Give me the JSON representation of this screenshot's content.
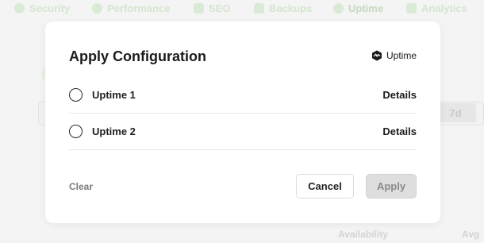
{
  "background": {
    "nav": [
      {
        "label": "Security",
        "icon": "shield-icon"
      },
      {
        "label": "Performance",
        "icon": "gauge-icon"
      },
      {
        "label": "SEO",
        "icon": "list-icon"
      },
      {
        "label": "Backups",
        "icon": "database-icon"
      },
      {
        "label": "Uptime",
        "icon": "uptime-icon"
      },
      {
        "label": "Analytics",
        "icon": "chart-icon"
      }
    ],
    "range_chip": "7d",
    "footer": {
      "availability": "Availability",
      "avg": "Avg"
    }
  },
  "modal": {
    "title": "Apply Configuration",
    "brand": {
      "label": "Uptime",
      "icon": "uptime-logo-icon"
    },
    "options": [
      {
        "label": "Uptime 1",
        "details": "Details",
        "selected": false
      },
      {
        "label": "Uptime 2",
        "details": "Details",
        "selected": false
      }
    ],
    "clear_label": "Clear",
    "cancel_label": "Cancel",
    "apply_label": "Apply"
  }
}
